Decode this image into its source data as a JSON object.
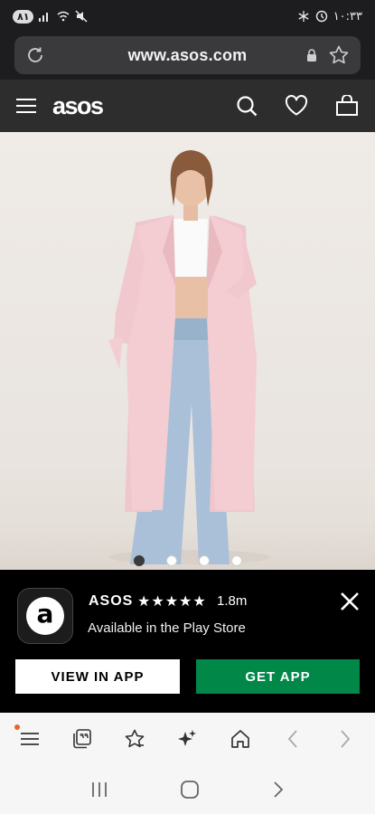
{
  "status_bar": {
    "battery": "۸۱",
    "time": "۱۰:۳۳"
  },
  "browser": {
    "url": "www.asos.com"
  },
  "site_header": {
    "logo": "asos"
  },
  "carousel": {
    "slide_count": 4,
    "active_index": 0
  },
  "app_banner": {
    "app_name": "ASOS",
    "stars": "★★★★★",
    "rating_count": "1.8m",
    "subtitle": "Available in the Play Store",
    "view_in_app_label": "VIEW IN APP",
    "get_app_label": "GET APP",
    "get_app_color": "#018849"
  },
  "toolbar": {
    "tabs_count": "۹۹"
  },
  "icons": {
    "reload": "reload-icon",
    "lock": "lock-icon",
    "bookmark": "star-outline-icon",
    "menu": "hamburger-menu-icon",
    "search": "search-icon",
    "wishlist": "heart-icon",
    "bag": "shopping-bag-icon",
    "close": "close-icon"
  }
}
